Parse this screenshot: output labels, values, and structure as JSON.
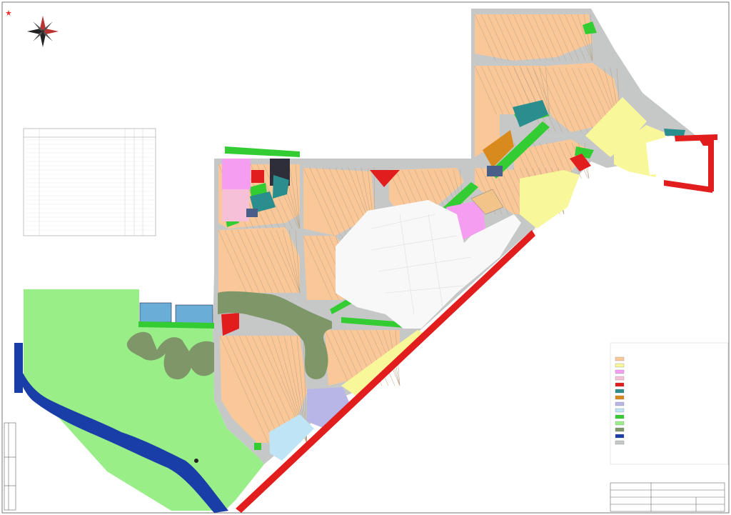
{
  "sheet_title": "",
  "explication_title": "",
  "legend_title": "",
  "compass": {
    "labels": [
      "",
      "",
      "",
      ""
    ]
  },
  "colors": {
    "background": "#ffffff",
    "road": "#c6c8c8",
    "residential": "#fac898",
    "park": "#7f9668",
    "green": "#99ee88",
    "bright_green": "#33cc33",
    "yellow_zone": "#f8f89a",
    "light_blue": "#bfe4f6",
    "lavender": "#b8b6e6",
    "red_line": "#e21d1d",
    "magenta": "#f59df0",
    "pink": "#f6c0d8",
    "teal": "#2a8e8e",
    "orange": "#d98a1c",
    "river": "#1a3ea8"
  }
}
